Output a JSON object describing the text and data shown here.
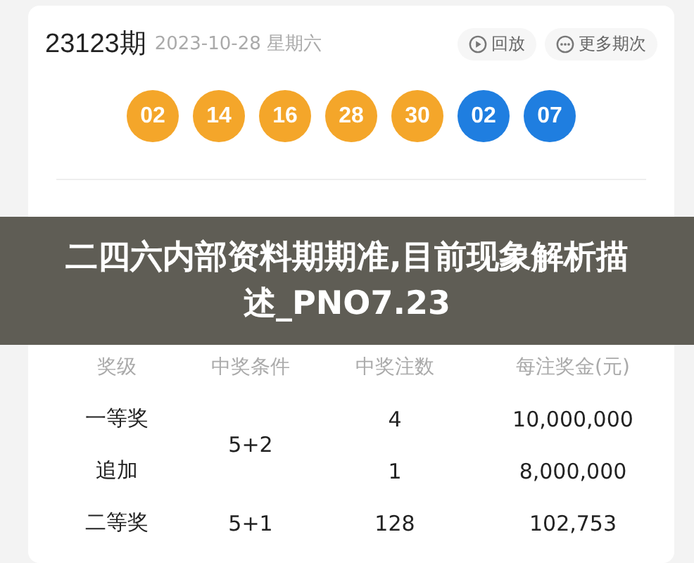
{
  "draw": {
    "issue": "23123期",
    "date": "2023-10-28 星期六",
    "actions": [
      {
        "kind": "replay",
        "label": "回放"
      },
      {
        "kind": "more",
        "label": "更多期次"
      }
    ]
  },
  "balls": [
    {
      "number": "02",
      "color": "#f4a62a"
    },
    {
      "number": "14",
      "color": "#f4a62a"
    },
    {
      "number": "16",
      "color": "#f4a62a"
    },
    {
      "number": "28",
      "color": "#f4a62a"
    },
    {
      "number": "30",
      "color": "#f4a62a"
    },
    {
      "number": "02",
      "color": "#1f7ee0"
    },
    {
      "number": "07",
      "color": "#1f7ee0"
    }
  ],
  "banner": {
    "title": "二四六内部资料期期准,目前现象解析描述_PNO7.23"
  },
  "prize_table": {
    "columns": [
      "奖级",
      "中奖条件",
      "中奖注数",
      "每注奖金(元)"
    ],
    "rows": [
      {
        "level": "一等奖",
        "condition": "5+2",
        "count": "4",
        "amount": "10,000,000"
      },
      {
        "level": "追加",
        "count": "1",
        "amount": "8,000,000"
      },
      {
        "level": "二等奖",
        "condition": "5+1",
        "count": "128",
        "amount": "102,753"
      }
    ]
  }
}
